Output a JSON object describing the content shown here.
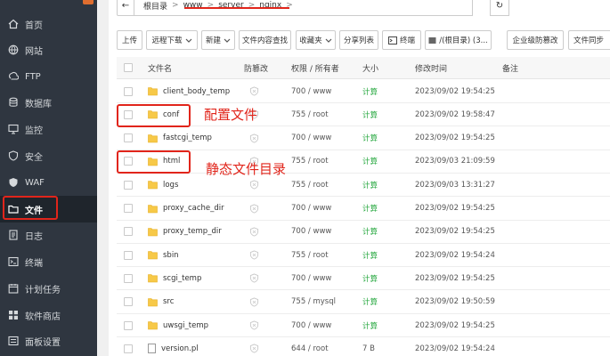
{
  "sidebar": {
    "items": [
      {
        "label": "首页",
        "icon": "home-icon"
      },
      {
        "label": "网站",
        "icon": "globe-icon"
      },
      {
        "label": "FTP",
        "icon": "ftp-icon"
      },
      {
        "label": "数据库",
        "icon": "database-icon"
      },
      {
        "label": "监控",
        "icon": "monitor-icon"
      },
      {
        "label": "安全",
        "icon": "shield-icon"
      },
      {
        "label": "WAF",
        "icon": "waf-icon"
      },
      {
        "label": "文件",
        "icon": "folder-icon"
      },
      {
        "label": "日志",
        "icon": "log-icon"
      },
      {
        "label": "终端",
        "icon": "terminal-icon"
      },
      {
        "label": "计划任务",
        "icon": "calendar-icon"
      },
      {
        "label": "软件商店",
        "icon": "store-icon"
      },
      {
        "label": "面板设置",
        "icon": "settings-icon"
      }
    ],
    "active_index": 7
  },
  "breadcrumb": {
    "back": "←",
    "segments": [
      "根目录",
      "www",
      "server",
      "nginx"
    ],
    "separator": ">",
    "refresh": "↻"
  },
  "toolbar": {
    "upload": "上传",
    "remote_download": "远程下载",
    "new": "新建",
    "content_search": "文件内容查找",
    "favorites": "收藏夹",
    "share_list": "分享列表",
    "terminal": "终端",
    "root_dir": "/(根目录) (3...",
    "enterprise_protect": "企业级防篡改",
    "file_sync": "文件同步"
  },
  "table": {
    "headers": {
      "name": "文件名",
      "tamper": "防篡改",
      "perm": "权限 / 所有者",
      "size": "大小",
      "mtime": "修改时间",
      "remark": "备注"
    },
    "rows": [
      {
        "name": "client_body_temp",
        "type": "folder",
        "perm": "700 / www",
        "size": "计算",
        "mtime": "2023/09/02 19:54:25"
      },
      {
        "name": "conf",
        "type": "folder",
        "perm": "755 / root",
        "size": "计算",
        "mtime": "2023/09/02 19:58:47"
      },
      {
        "name": "fastcgi_temp",
        "type": "folder",
        "perm": "700 / www",
        "size": "计算",
        "mtime": "2023/09/02 19:54:25"
      },
      {
        "name": "html",
        "type": "folder",
        "perm": "755 / root",
        "size": "计算",
        "mtime": "2023/09/03 21:09:59"
      },
      {
        "name": "logs",
        "type": "folder",
        "perm": "755 / root",
        "size": "计算",
        "mtime": "2023/09/03 13:31:27"
      },
      {
        "name": "proxy_cache_dir",
        "type": "folder",
        "perm": "700 / www",
        "size": "计算",
        "mtime": "2023/09/02 19:54:25"
      },
      {
        "name": "proxy_temp_dir",
        "type": "folder",
        "perm": "700 / www",
        "size": "计算",
        "mtime": "2023/09/02 19:54:25"
      },
      {
        "name": "sbin",
        "type": "folder",
        "perm": "755 / root",
        "size": "计算",
        "mtime": "2023/09/02 19:54:24"
      },
      {
        "name": "scgi_temp",
        "type": "folder",
        "perm": "700 / www",
        "size": "计算",
        "mtime": "2023/09/02 19:54:25"
      },
      {
        "name": "src",
        "type": "folder",
        "perm": "755 / mysql",
        "size": "计算",
        "mtime": "2023/09/02 19:50:59"
      },
      {
        "name": "uwsgi_temp",
        "type": "folder",
        "perm": "700 / www",
        "size": "计算",
        "mtime": "2023/09/02 19:54:25"
      },
      {
        "name": "version.pl",
        "type": "file",
        "perm": "644 / root",
        "size": "7 B",
        "mtime": "2023/09/02 19:54:24"
      }
    ]
  },
  "annotations": {
    "conf_label": "配置文件",
    "html_label": "静态文件目录"
  },
  "colors": {
    "sidebar_bg": "#2f3640",
    "accent_green": "#20a53a",
    "annotation_red": "#e1251b",
    "folder_yellow": "#f7c948"
  }
}
